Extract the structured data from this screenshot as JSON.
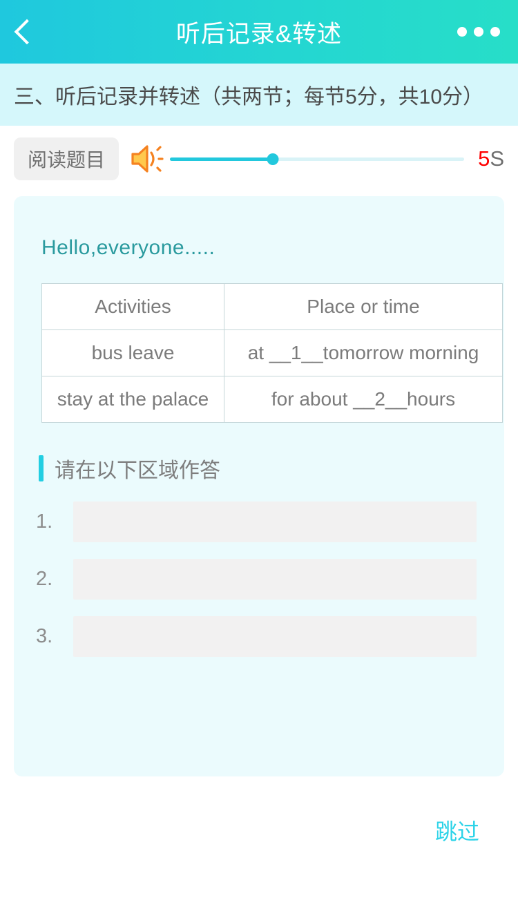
{
  "header": {
    "title": "听后记录&转述",
    "back_icon": "chevron-left-icon",
    "more_icon": "more-dots-icon",
    "gradient_start": "#1fc8de",
    "gradient_end": "#27dec8"
  },
  "section": {
    "text": "三、听后记录并转述（共两节；每节5分，共10分）",
    "background": "#d5f7fb"
  },
  "audio": {
    "read_button_label": "阅读题目",
    "speaker_icon": "speaker-volume-icon",
    "progress_percent": 35,
    "timer_value": "5",
    "timer_unit": "S",
    "timer_value_color": "#ff0000",
    "accent": "#22c8dd"
  },
  "content": {
    "greeting": "Hello,everyone.....",
    "table": {
      "headers": [
        "Activities",
        "Place or time"
      ],
      "rows": [
        [
          "bus leave",
          "at __1__tomorrow morning"
        ],
        [
          "stay at the palace",
          "for about __2__hours"
        ]
      ]
    },
    "answer_section": {
      "heading": "请在以下区域作答",
      "accent_color": "#22cee2",
      "rows": [
        {
          "number": "1.",
          "value": "",
          "placeholder": ""
        },
        {
          "number": "2.",
          "value": "",
          "placeholder": ""
        },
        {
          "number": "3.",
          "value": "",
          "placeholder": ""
        }
      ]
    }
  },
  "footer": {
    "skip_label": "跳过",
    "skip_color": "#2bd3e8"
  }
}
